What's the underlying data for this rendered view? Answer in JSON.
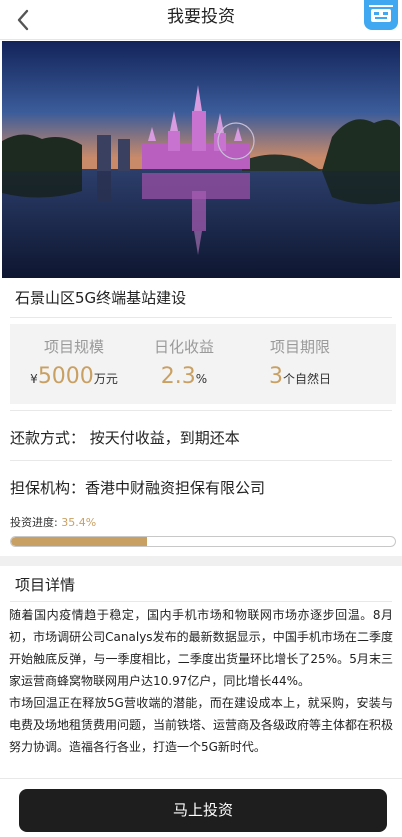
{
  "header": {
    "title": "我要投资"
  },
  "project": {
    "name": "石景山区5G终端基站建设"
  },
  "stats": {
    "scale": {
      "label": "项目规模",
      "prefix": "¥",
      "value": "5000",
      "unit": "万元"
    },
    "daily_return": {
      "label": "日化收益",
      "value": "2.3",
      "unit": "%"
    },
    "term": {
      "label": "项目期限",
      "value": "3",
      "unit": "个自然日"
    }
  },
  "repayment": {
    "text": "还款方式：  按天付收益，到期还本"
  },
  "guarantor": {
    "text": "担保机构：香港中财融资担保有限公司"
  },
  "progress": {
    "label": "投资进度:",
    "value_text": "35.4%",
    "fraction": 0.354
  },
  "detail": {
    "title": "项目详情",
    "paragraphs": [
      "随着国内疫情趋于稳定，国内手机市场和物联网市场亦逐步回温。8月初，市场调研公司Canalys发布的最新数据显示，中国手机市场在二季度开始触底反弹，与一季度相比，二季度出货量环比增长了25%。5月末三家运营商蜂窝物联网用户达10.97亿户，同比增长44%。",
      "市场回温正在释放5G营收端的潜能，而在建设成本上，就采购，安装与电费及场地租赁费用问题，当前铁塔、运营商及各级政府等主体都在积极努力协调。造福各行各业，打造一个5G新时代。"
    ]
  },
  "action": {
    "invest_label": "马上投资"
  },
  "colors": {
    "accent": "#c9a063",
    "button": "#1e1e1e",
    "corner_badge": "#3fa8f0"
  },
  "icons": {
    "back": "chevron-left-icon",
    "corner": "service-badge-icon"
  }
}
